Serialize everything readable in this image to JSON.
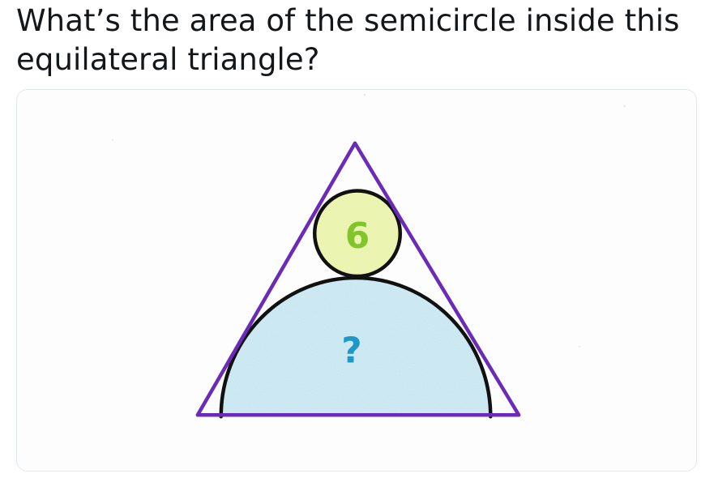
{
  "question": {
    "text": "What’s the area of the semicircle inside this equilateral triangle?"
  },
  "puzzle": {
    "circle_label": "6",
    "semicircle_label": "?",
    "colors": {
      "paper": "#fdfdfd",
      "triangle_stroke": "#6a2bb8",
      "outline_stroke": "#111111",
      "circle_fill": "#e6f29a",
      "circle_label_color": "#7fc62a",
      "semicircle_fill": "#bfe3ef",
      "semicircle_label_color": "#1e98c9",
      "card_border": "#e1e8ed"
    }
  }
}
